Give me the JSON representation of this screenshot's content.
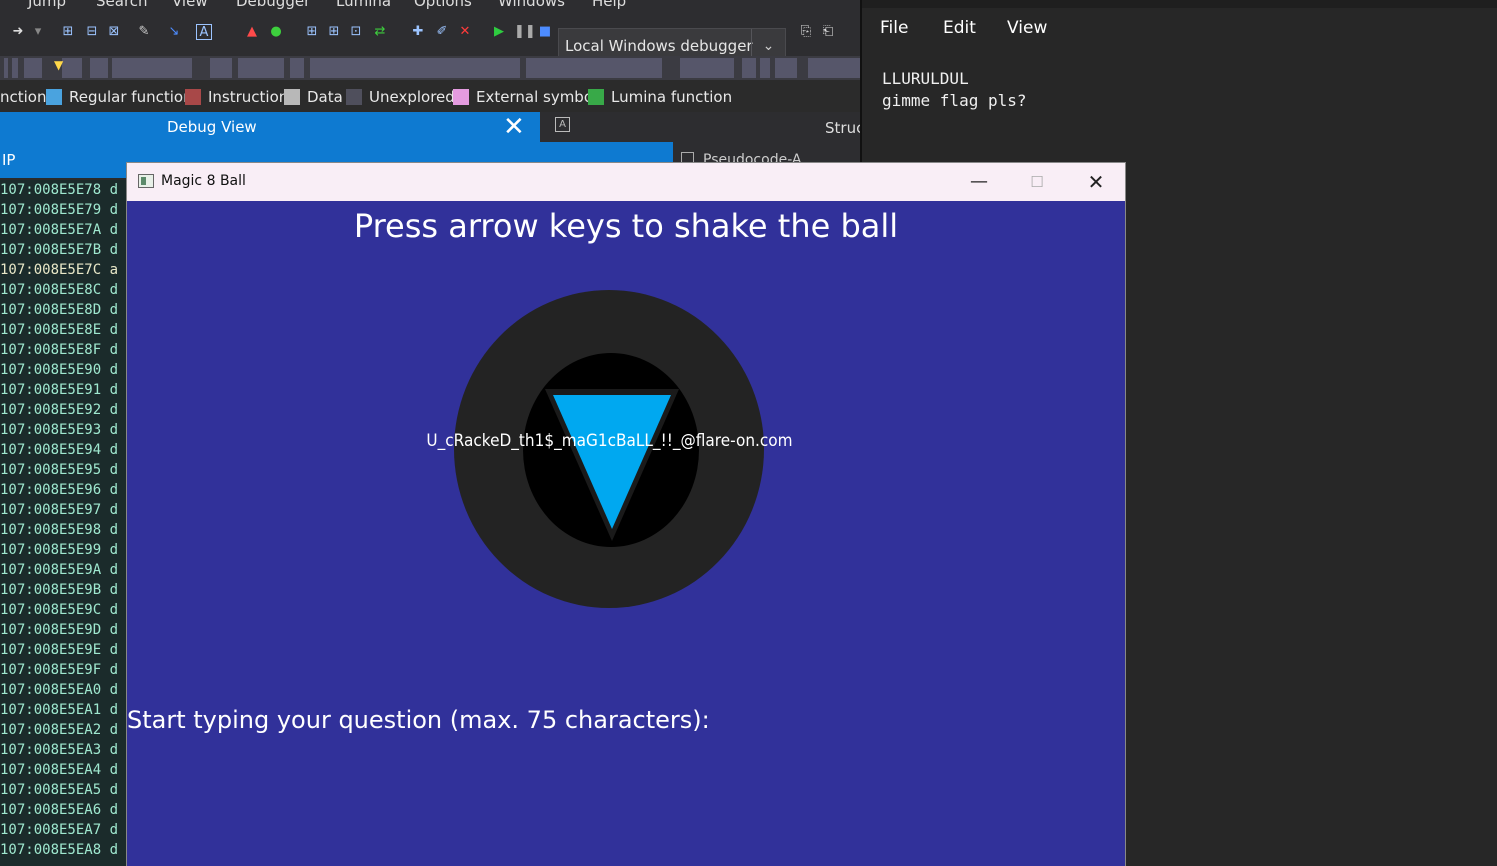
{
  "ida": {
    "menu": [
      "Jump",
      "Search",
      "View",
      "Debugger",
      "Lumina",
      "Options",
      "Windows",
      "Help"
    ],
    "debugger_select": "Local Windows debugger",
    "legend": [
      {
        "label": "nction",
        "color": null
      },
      {
        "label": "Regular function",
        "color": "#4aa3df"
      },
      {
        "label": "Instruction",
        "color": "#a84848"
      },
      {
        "label": "Data",
        "color": "#b8b8b8"
      },
      {
        "label": "Unexplored",
        "color": "#4f4f5c"
      },
      {
        "label": "External symbol",
        "color": "#e49be0"
      },
      {
        "label": "Lumina function",
        "color": "#38a948"
      }
    ],
    "debug_view_title": "Debug View",
    "structures_tab": "Struct",
    "ip_label": "IP",
    "pseudocode_tab": "Pseudocode-A",
    "addresses": [
      "107:008E5E78 d",
      "107:008E5E79 d",
      "107:008E5E7A d",
      "107:008E5E7B d",
      "107:008E5E7C a",
      "107:008E5E8C d",
      "107:008E5E8D d",
      "107:008E5E8E d",
      "107:008E5E8F d",
      "107:008E5E90 d",
      "107:008E5E91 d",
      "107:008E5E92 d",
      "107:008E5E93 d",
      "107:008E5E94 d",
      "107:008E5E95 d",
      "107:008E5E96 d",
      "107:008E5E97 d",
      "107:008E5E98 d",
      "107:008E5E99 d",
      "107:008E5E9A d",
      "107:008E5E9B d",
      "107:008E5E9C d",
      "107:008E5E9D d",
      "107:008E5E9E d",
      "107:008E5E9F d",
      "107:008E5EA0 d",
      "107:008E5EA1 d",
      "107:008E5EA2 d",
      "107:008E5EA3 d",
      "107:008E5EA4 d",
      "107:008E5EA5 d",
      "107:008E5EA6 d",
      "107:008E5EA7 d",
      "107:008E5EA8 d"
    ]
  },
  "notepad": {
    "menu": {
      "file": "File",
      "edit": "Edit",
      "view": "View"
    },
    "line1": "LLURULDUL",
    "line2": "gimme flag pls?"
  },
  "magic_window": {
    "title": "Magic 8 Ball",
    "heading": "Press arrow keys to shake the ball",
    "answer": "U_cRackeD_th1$_maG1cBaLL_!!_@flare-on.com",
    "prompt": "Start typing your question (max. 75 characters):",
    "colors": {
      "background": "#31319a",
      "ball": "#232323",
      "triangle": "#00a8f0"
    }
  }
}
